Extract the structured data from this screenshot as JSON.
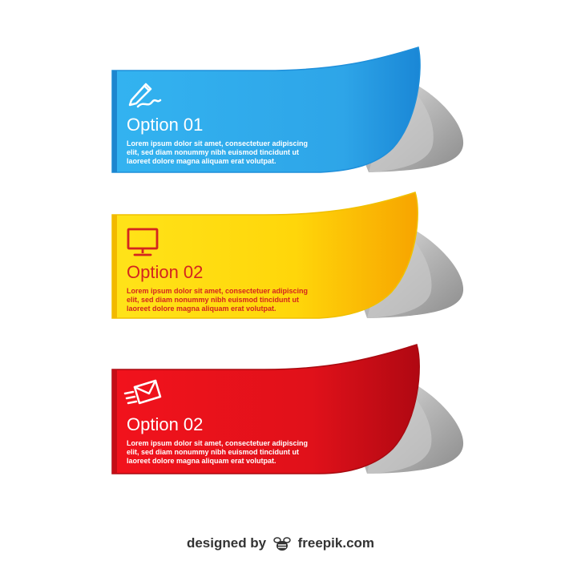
{
  "banners": [
    {
      "title": "Option 01",
      "icon": "pen-icon",
      "color": "#2fa8e6",
      "text": [
        "Lorem ipsum dolor sit amet, consectetuer adipiscing",
        "elit, sed diam nonummy nibh euismod tincidunt ut",
        "laoreet dolore magna aliquam erat volutpat."
      ]
    },
    {
      "title": "Option 02",
      "icon": "monitor-icon",
      "color": "#ffd60a",
      "text": [
        "Lorem ipsum dolor sit amet, consectetuer adipiscing",
        "elit, sed diam nonummy nibh euismod tincidunt ut",
        "laoreet dolore magna aliquam erat volutpat."
      ]
    },
    {
      "title": "Option 02",
      "icon": "email-icon",
      "color": "#e8141c",
      "text": [
        "Lorem ipsum dolor sit amet, consectetuer adipiscing",
        "elit, sed diam nonummy nibh euismod tincidunt ut",
        "laoreet dolore magna aliquam erat volutpat."
      ]
    }
  ],
  "credit": {
    "prefix": "designed by",
    "brand": "freepik.com"
  }
}
